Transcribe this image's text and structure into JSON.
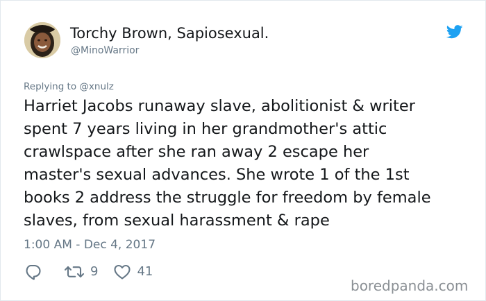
{
  "user": {
    "name": "Torchy Brown, Sapiosexual.",
    "handle": "@MinoWarrior",
    "avatar_icon": "profile-photo"
  },
  "platform_icon": "twitter-bird-icon",
  "colors": {
    "brand": "#1da1f2",
    "text": "#14171a",
    "secondary": "#657786",
    "border": "#e1e8ed"
  },
  "tweet": {
    "replying_to": "Replying to @xnulz",
    "text_lines": [
      "Harriet Jacobs runaway slave, abolitionist & writer",
      "spent 7 years living in her grandmother's attic",
      "crawlspace after she ran away 2 escape her",
      "master's sexual advances. She wrote 1 of the 1st",
      "books 2 address the struggle for freedom by female",
      "slaves, from sexual harassment & rape"
    ],
    "timestamp": "1:00 AM - Dec 4, 2017"
  },
  "actions": {
    "reply_icon": "reply-icon",
    "retweet_icon": "retweet-icon",
    "retweet_count": "9",
    "like_icon": "heart-icon",
    "like_count": "41"
  },
  "watermark": "boredpanda.com"
}
